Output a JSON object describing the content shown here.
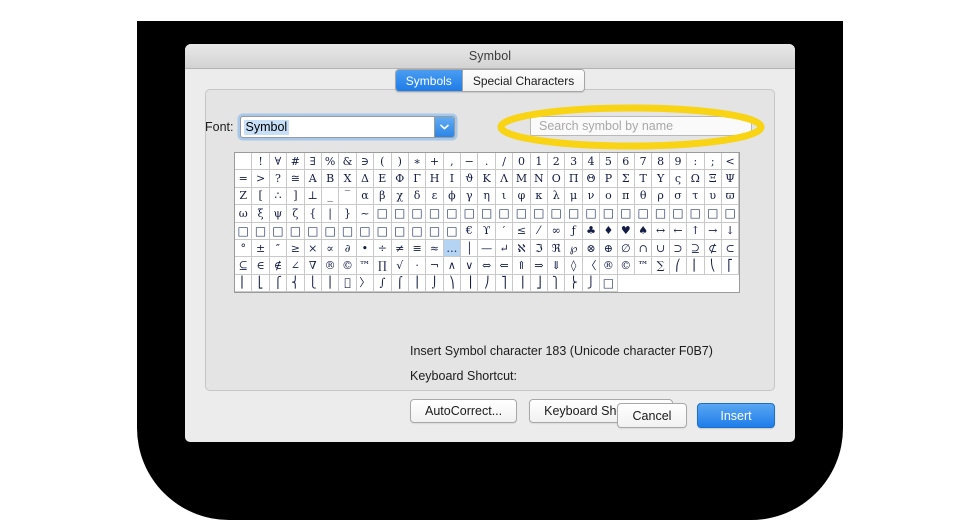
{
  "window": {
    "title": "Symbol"
  },
  "tabs": [
    {
      "label": "Symbols",
      "active": true
    },
    {
      "label": "Special Characters",
      "active": false
    }
  ],
  "font": {
    "label": "Font:",
    "value": "Symbol",
    "dropdown_icon": "chevron-down-icon"
  },
  "search": {
    "value": "",
    "placeholder": "Search symbol by name"
  },
  "annotation": {
    "shape": "ellipse",
    "color": "#F8D414",
    "target": "search-input"
  },
  "grid": {
    "columns": 29,
    "selected_index": 157,
    "cells": [
      " ",
      "!",
      "∀",
      "#",
      "∃",
      "%",
      "&",
      "∋",
      "(",
      ")",
      "∗",
      "+",
      ",",
      "−",
      ".",
      "/",
      "0",
      "1",
      "2",
      "3",
      "4",
      "5",
      "6",
      "7",
      "8",
      "9",
      ":",
      ";",
      "<",
      "=",
      ">",
      "?",
      "≅",
      "Α",
      "Β",
      "Χ",
      "Δ",
      "Ε",
      "Φ",
      "Γ",
      "Η",
      "Ι",
      "ϑ",
      "Κ",
      "Λ",
      "Μ",
      "Ν",
      "Ο",
      "Π",
      "Θ",
      "Ρ",
      "Σ",
      "Τ",
      "Υ",
      "ς",
      "Ω",
      "Ξ",
      "Ψ",
      "Ζ",
      "[",
      "∴",
      "]",
      "⊥",
      "_",
      "‾",
      "α",
      "β",
      "χ",
      "δ",
      "ε",
      "ϕ",
      "γ",
      "η",
      "ι",
      "φ",
      "κ",
      "λ",
      "μ",
      "ν",
      "ο",
      "π",
      "θ",
      "ρ",
      "σ",
      "τ",
      "υ",
      "ϖ",
      "ω",
      "ξ",
      "ψ",
      "ζ",
      "{",
      "|",
      "}",
      "~",
      "▢",
      "▢",
      "▢",
      "▢",
      "▢",
      "▢",
      "▢",
      "▢",
      "▢",
      "▢",
      "▢",
      "▢",
      "▢",
      "▢",
      "▢",
      "▢",
      "▢",
      "▢",
      "▢",
      "▢",
      "▢",
      "▢",
      "▢",
      "▢",
      "▢",
      "▢",
      "▢",
      "▢",
      "▢",
      "▢",
      "▢",
      "▢",
      "▢",
      "▢",
      "€",
      "ϒ",
      "′",
      "≤",
      "⁄",
      "∞",
      "ƒ",
      "♣",
      "♦",
      "♥",
      "♠",
      "↔",
      "←",
      "↑",
      "→",
      "↓",
      "°",
      "±",
      "″",
      "≥",
      "×",
      "∝",
      "∂",
      "•",
      "÷",
      "≠",
      "≡",
      "≈",
      "…",
      "│",
      "—",
      "↵",
      "ℵ",
      "ℑ",
      "ℜ",
      "℘",
      "⊗",
      "⊕",
      "∅",
      "∩",
      "∪",
      "⊃",
      "⊇",
      "⊄",
      "⊂",
      "⊆",
      "∈",
      "∉",
      "∠",
      "∇",
      "®",
      "©",
      "™",
      "∏",
      "√",
      "·",
      "¬",
      "∧",
      "∨",
      "⇔",
      "⇐",
      "⇑",
      "⇒",
      "⇓",
      "◊",
      "〈",
      "®",
      "©",
      "™",
      "∑",
      "⎛",
      "⎜",
      "⎝",
      "⎡",
      "⎢",
      "⎣",
      "⎧",
      "⎨",
      "⎩",
      "⎪",
      "",
      "〉",
      "∫",
      "⌠",
      "⎮",
      "⌡",
      "⎞",
      "⎟",
      "⎠",
      "⎤",
      "⎥",
      "⎦",
      "⎫",
      "⎬",
      "⎭",
      "▢"
    ]
  },
  "info": {
    "insert_text": "Insert Symbol character 183  (Unicode character F0B7)",
    "keyboard_shortcut_label": "Keyboard Shortcut:"
  },
  "panel_buttons": [
    {
      "label": "AutoCorrect..."
    },
    {
      "label": "Keyboard Shortcut..."
    }
  ],
  "footer_buttons": [
    {
      "label": "Cancel",
      "style": "secondary"
    },
    {
      "label": "Insert",
      "style": "primary"
    }
  ],
  "colors": {
    "accent": "#1f7ee9",
    "annotation": "#F8D414",
    "selection": "#b5d3f2",
    "backdrop": "#000000"
  }
}
